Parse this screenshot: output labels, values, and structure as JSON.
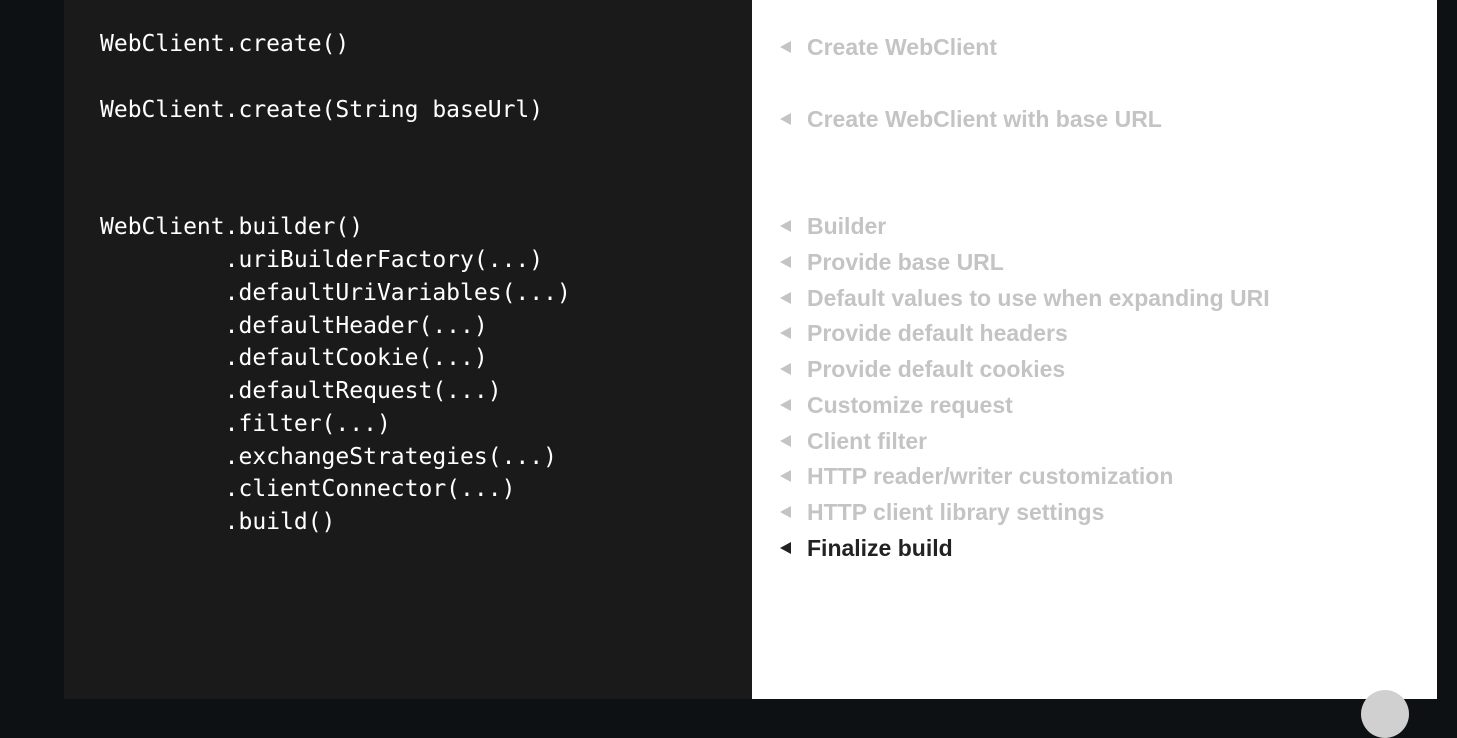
{
  "code": {
    "lines": [
      "WebClient.create()",
      "WebClient.create(String baseUrl)",
      "WebClient.builder()",
      "         .uriBuilderFactory(...)",
      "         .defaultUriVariables(...)",
      "         .defaultHeader(...)",
      "         .defaultCookie(...)",
      "         .defaultRequest(...)",
      "         .filter(...)",
      "         .exchangeStrategies(...)",
      "         .clientConnector(...)",
      "         .build()"
    ]
  },
  "notes": {
    "items": [
      {
        "label": "Create WebClient",
        "state": "dimmed"
      },
      {
        "label": "Create WebClient with base URL",
        "state": "dimmed"
      },
      {
        "label": "Builder",
        "state": "dimmed"
      },
      {
        "label": "Provide base URL",
        "state": "dimmed"
      },
      {
        "label": "Default values to use when expanding URI",
        "state": "dimmed"
      },
      {
        "label": "Provide default headers",
        "state": "dimmed"
      },
      {
        "label": "Provide default cookies",
        "state": "dimmed"
      },
      {
        "label": "Customize request",
        "state": "dimmed"
      },
      {
        "label": "Client filter",
        "state": "dimmed"
      },
      {
        "label": "HTTP reader/writer customization",
        "state": "dimmed"
      },
      {
        "label": "HTTP client library settings",
        "state": "dimmed"
      },
      {
        "label": "Finalize build",
        "state": "active"
      }
    ],
    "arrow_icon": "left-triangle-icon"
  },
  "colors": {
    "code_background": "#1a1a1a",
    "code_text": "#ffffff",
    "note_dimmed": "#c4c4c4",
    "note_active": "#222222",
    "page_background": "#0d1114"
  }
}
